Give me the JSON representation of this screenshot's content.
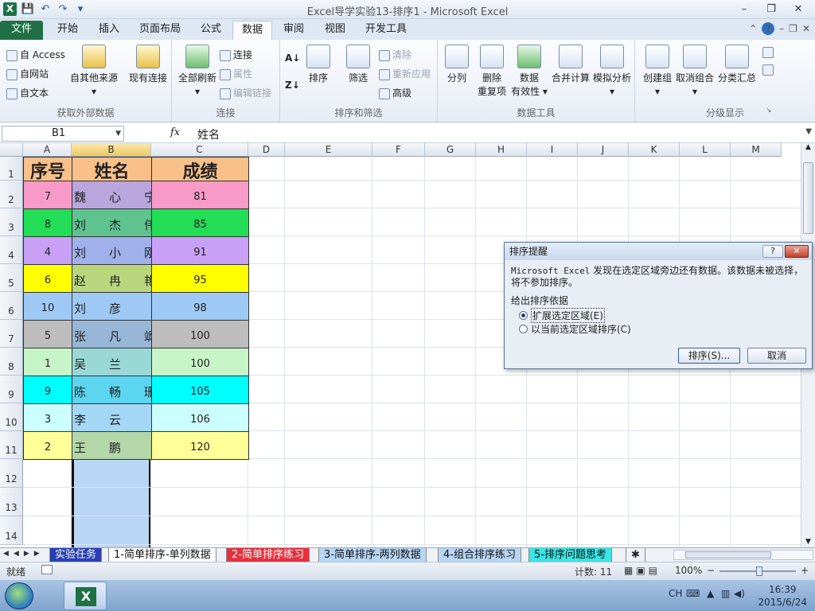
{
  "app": {
    "title": "Excel导学实验13-排序1  -  Microsoft Excel",
    "logo_letter": "X"
  },
  "qat": {
    "save": "💾",
    "undo": "↶",
    "redo": "↷",
    "more": "▾"
  },
  "window_controls": {
    "minimize": "–",
    "restore": "❐",
    "close": "✕"
  },
  "tabs": [
    {
      "label": "文件"
    },
    {
      "label": "开始"
    },
    {
      "label": "插入"
    },
    {
      "label": "页面布局"
    },
    {
      "label": "公式"
    },
    {
      "label": "数据"
    },
    {
      "label": "审阅"
    },
    {
      "label": "视图"
    },
    {
      "label": "开发工具"
    }
  ],
  "ribbon": {
    "groups": {
      "external": {
        "label": "获取外部数据",
        "access": "自 Access",
        "web": "自网站",
        "text": "自文本",
        "other": "自其他来源",
        "existing": "现有连接"
      },
      "connections": {
        "label": "连接",
        "refresh_all": "全部刷新",
        "connections": "连接",
        "properties": "属性",
        "edit_links": "编辑链接"
      },
      "sort_filter": {
        "label": "排序和筛选",
        "sort": "排序",
        "filter": "筛选",
        "clear": "清除",
        "reapply": "重新应用",
        "advanced": "高级"
      },
      "data_tools": {
        "label": "数据工具",
        "text_to_columns": "分列",
        "remove_dup_1": "删除",
        "remove_dup_2": "重复项",
        "validation_1": "数据",
        "validation_2": "有效性",
        "consolidate": "合并计算",
        "whatif": "模拟分析"
      },
      "outline": {
        "label": "分级显示",
        "group": "创建组",
        "ungroup": "取消组合",
        "subtotal": "分类汇总"
      }
    }
  },
  "formula_bar": {
    "name_box": "B1",
    "fx": "fx",
    "content": "姓名"
  },
  "columns": [
    "A",
    "B",
    "C",
    "D",
    "E",
    "F",
    "G",
    "H",
    "I",
    "J",
    "K",
    "L",
    "M"
  ],
  "rows": [
    "1",
    "2",
    "3",
    "4",
    "5",
    "6",
    "7",
    "8",
    "9",
    "10",
    "11",
    "12",
    "13",
    "14"
  ],
  "table": {
    "headers": [
      "序号",
      "姓名",
      "成绩"
    ],
    "header_color": "#f9c08a",
    "rows": [
      {
        "no": "7",
        "name": "魏心宁",
        "score": "81",
        "a": "#f79ac8",
        "b": "#b9a6dc",
        "c": "#f79ac8"
      },
      {
        "no": "8",
        "name": "刘杰伟",
        "score": "85",
        "a": "#22dd55",
        "b": "#5ec38f",
        "c": "#22dd55"
      },
      {
        "no": "4",
        "name": "刘小刚",
        "score": "91",
        "a": "#c8a0f5",
        "b": "#9fb0ea",
        "c": "#c8a0f5"
      },
      {
        "no": "6",
        "name": "赵冉艳",
        "score": "95",
        "a": "#ffff00",
        "b": "#b8d77c",
        "c": "#ffff00"
      },
      {
        "no": "10",
        "name": "刘彦",
        "score": "98",
        "a": "#9fc9f5",
        "b": "#9fc9f5",
        "c": "#9fc9f5"
      },
      {
        "no": "5",
        "name": "张凡飒",
        "score": "100",
        "a": "#bdbdbd",
        "b": "#98b6d6",
        "c": "#bdbdbd"
      },
      {
        "no": "1",
        "name": "吴兰",
        "score": "100",
        "a": "#c8f5c8",
        "b": "#9ad8d8",
        "c": "#c8f5c8"
      },
      {
        "no": "9",
        "name": "陈畅珊",
        "score": "105",
        "a": "#00ffff",
        "b": "#5cd5f0",
        "c": "#00ffff"
      },
      {
        "no": "3",
        "name": "李云",
        "score": "106",
        "a": "#ccffff",
        "b": "#a3d7f5",
        "c": "#ccffff"
      },
      {
        "no": "2",
        "name": "王鹏",
        "score": "120",
        "a": "#ffff99",
        "b": "#b3d7a8",
        "c": "#ffff99"
      }
    ]
  },
  "dialog": {
    "title": "排序提醒",
    "help": "?",
    "close": "✕",
    "message_mono": "Microsoft Excel",
    "message_rest": " 发现在选定区域旁边还有数据。该数据未被选择，将不参加排序。",
    "group_label": "给出排序依据",
    "option_expand": "扩展选定区域(E)",
    "option_current": "以当前选定区域排序(C)",
    "sort_button": "排序(S)...",
    "cancel_button": "取消"
  },
  "sheet_tabs": [
    {
      "label": "实验任务",
      "bg": "#2b3fb3",
      "fg": "#ffffff"
    },
    {
      "label": "1-简单排序-单列数据",
      "bg": "#ffffff",
      "fg": "#111111"
    },
    {
      "label": "2-简单排序练习",
      "bg": "#e8303c",
      "fg": "#ffffff"
    },
    {
      "label": "3-简单排序-两列数据",
      "bg": "#b7d6f5",
      "fg": "#111111"
    },
    {
      "label": "4-组合排序练习",
      "bg": "#b7d6f5",
      "fg": "#111111"
    },
    {
      "label": "5-排序问题思考",
      "bg": "#39e6e6",
      "fg": "#111111"
    }
  ],
  "status": {
    "ready": "就绪",
    "count": "计数: 11",
    "zoom": "100%",
    "zoom_out": "−",
    "zoom_in": "+"
  },
  "taskbar": {
    "lang": "CH",
    "time": "16:39",
    "date": "2015/6/24"
  },
  "colors": {
    "excel_green": "#1f7145",
    "selection": "#b9d7f5"
  }
}
